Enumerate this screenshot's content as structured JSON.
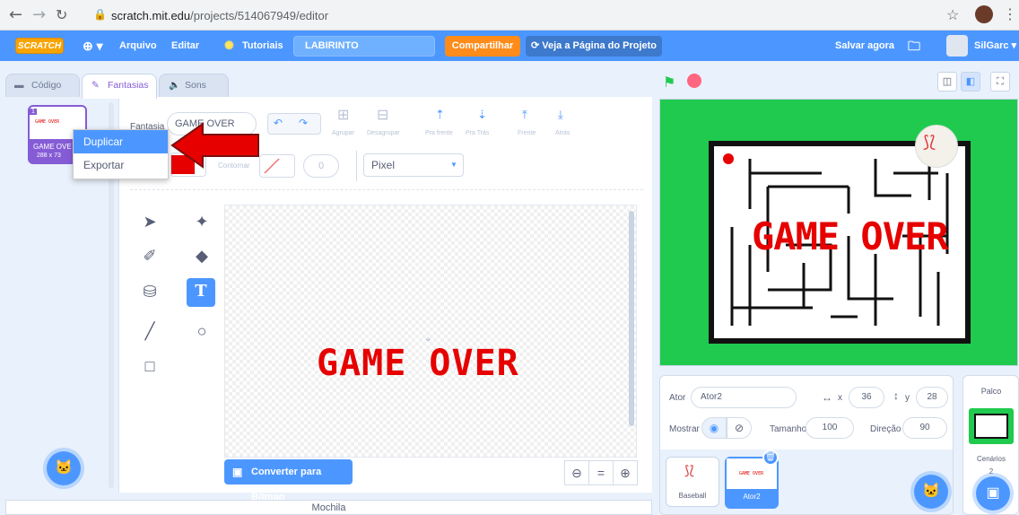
{
  "browser": {
    "url_host": "scratch.mit.edu",
    "url_path": "/projects/514067949/editor"
  },
  "menubar": {
    "logo": "SCRATCH",
    "file": "Arquivo",
    "edit": "Editar",
    "tutorials": "Tutoriais",
    "project_title": "LABIRINTO",
    "share": "Compartilhar",
    "see_project": "Veja a Página do Projeto",
    "save_now": "Salvar agora",
    "username": "SilGarc"
  },
  "tabs": [
    {
      "label": "Código"
    },
    {
      "label": "Fantasias"
    },
    {
      "label": "Sons"
    }
  ],
  "costume_list": {
    "items": [
      {
        "index": "1",
        "name": "GAME OVE",
        "size": "288 x 73",
        "thumb_text": "GAME OVER"
      }
    ]
  },
  "context_menu": {
    "items": [
      {
        "label": "Duplicar"
      },
      {
        "label": "Exportar"
      }
    ]
  },
  "paint_editor": {
    "costume_label": "Fantasia",
    "costume_name": "GAME OVER",
    "group": "Agrupar",
    "ungroup": "Desagrupar",
    "forward": "Pra frente",
    "backward": "Pra Trás",
    "front": "Frente",
    "back": "Atrás",
    "outline_label": "Contornar",
    "outline_width": "0",
    "mode": "Pixel",
    "fill_color": "#e60000",
    "canvas_text": "GAME OVER",
    "convert_button": "Converter para Bitmap"
  },
  "stage": {
    "text": "GAME OVER",
    "background_color": "#1fca4e"
  },
  "sprite_info": {
    "actor_label": "Ator",
    "actor_name": "Ator2",
    "x_label": "x",
    "x_value": "36",
    "y_label": "y",
    "y_value": "28",
    "show_label": "Mostrar",
    "size_label": "Tamanho",
    "size_value": "100",
    "direction_label": "Direção",
    "direction_value": "90"
  },
  "sprites": [
    {
      "name": "Baseball"
    },
    {
      "name": "Ator2",
      "thumb_text": "GAME OVER"
    }
  ],
  "stage_panel": {
    "title": "Palco",
    "backdrops_label": "Cenários",
    "backdrops_count": "2"
  },
  "backpack": {
    "label": "Mochila"
  },
  "colors": {
    "accent": "#4c97ff",
    "costume_accent": "#855cd6",
    "share": "#ff8c1a",
    "red_arrow": "#e60000"
  }
}
